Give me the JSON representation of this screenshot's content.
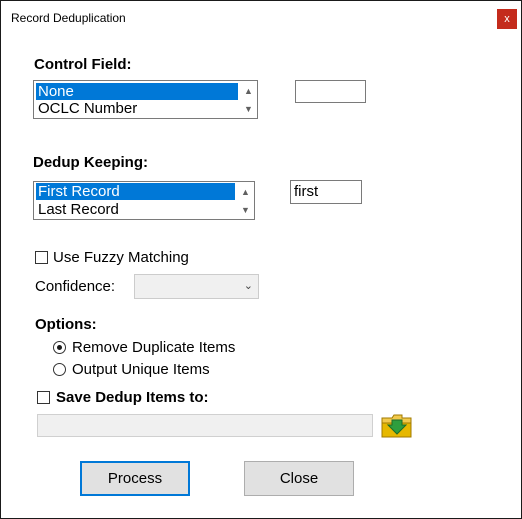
{
  "window": {
    "title": "Record Deduplication",
    "close_glyph": "x"
  },
  "control_field": {
    "label": "Control Field:",
    "options": [
      "None",
      "OCLC Number"
    ],
    "selected": "None",
    "text_value": ""
  },
  "dedup_keeping": {
    "label": "Dedup Keeping:",
    "options": [
      "First Record",
      "Last Record"
    ],
    "selected": "First Record",
    "text_value": "first"
  },
  "fuzzy": {
    "label": "Use Fuzzy Matching",
    "checked": false,
    "confidence_label": "Confidence:",
    "confidence_value": ""
  },
  "options": {
    "label": "Options:",
    "radios": [
      {
        "label": "Remove Duplicate Items",
        "selected": true
      },
      {
        "label": "Output Unique Items",
        "selected": false
      }
    ]
  },
  "save": {
    "label": "Save Dedup Items to:",
    "checked": false,
    "path_value": ""
  },
  "buttons": {
    "process": "Process",
    "close": "Close"
  },
  "colors": {
    "selection": "#0078d7",
    "close_button": "#c42b1c",
    "folder": "#e6b800",
    "folder_arrow": "#2e9e3e"
  },
  "icons": {
    "close": "close-icon",
    "browse": "folder-open-icon",
    "up": "chevron-up-icon",
    "down": "chevron-down-icon"
  }
}
